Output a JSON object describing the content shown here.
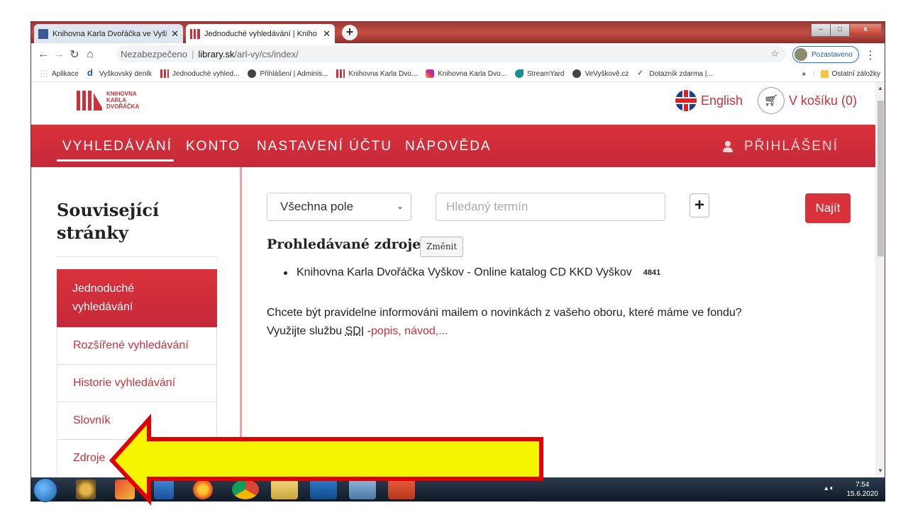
{
  "browser": {
    "tabs": [
      {
        "title": "Knihovna Karla Dvořáčka ve Vyšk",
        "active": false
      },
      {
        "title": "Jednoduché vyhledávání | Kniho",
        "active": true
      }
    ],
    "new_tab": "+",
    "window_buttons": {
      "minimize": "–",
      "maximize": "□",
      "close": "x"
    },
    "address": {
      "security": "Nezabezpečeno",
      "separator": "|",
      "host": "library.sk",
      "path": "/arl-vy/cs/index/"
    },
    "profile_label": "Pozastaveno",
    "bookmarks": [
      {
        "label": "Aplikace",
        "icon": "apps-icon"
      },
      {
        "label": "Vyškovský deník",
        "icon": "d-icon"
      },
      {
        "label": "Jednoduché vyhled...",
        "icon": "library-icon"
      },
      {
        "label": "Přihlášení | Adminis...",
        "icon": "globe-icon"
      },
      {
        "label": "Knihovna Karla Dvo...",
        "icon": "library-icon"
      },
      {
        "label": "Knihovna Karla Dvo...",
        "icon": "instagram-icon"
      },
      {
        "label": "StreamYard",
        "icon": "streamyard-icon"
      },
      {
        "label": "VeVyškově.cz",
        "icon": "globe-icon"
      },
      {
        "label": "Dotazník zdarma |...",
        "icon": "check-icon"
      }
    ],
    "bookmarks_more": "»",
    "bookmarks_other": "Ostatní záložky"
  },
  "site": {
    "logo_lines": [
      "KNIHOVNA",
      "KARLA",
      "DVOŘÁČKA"
    ],
    "language": "English",
    "cart": "V košíku (0)",
    "menu": [
      "VYHLEDÁVÁNÍ",
      "KONTO",
      "NASTAVENÍ ÚČTU",
      "NÁPOVĚDA"
    ],
    "login": "PŘIHLÁŠENÍ",
    "sidebar": {
      "title_line1": "Související",
      "title_line2": "stránky",
      "items": [
        {
          "line1": "Jednoduché",
          "line2": "vyhledávání",
          "active": true
        },
        {
          "label": "Rozšířené vyhledávání"
        },
        {
          "label": "Historie vyhledávání"
        },
        {
          "label": "Slovník"
        },
        {
          "label": "Zdroje"
        }
      ]
    },
    "search": {
      "field_select": "Všechna pole",
      "placeholder": "Hledaný termín",
      "plus": "+",
      "button": "Najít",
      "sources_title": "Prohledávané zdroje",
      "change_button": "Změnit",
      "source": "Knihovna Karla Dvořáčka Vyškov - Online katalog CD KKD Vyškov",
      "source_count": "4841",
      "info_line1": "Chcete být pravidelne informováni mailem o novinkách z vašeho oboru, které máme ve fondu?",
      "info_prefix": "Využijte službu",
      "info_abbr": "SDI",
      "info_dash": "-",
      "info_link": "popis, návod,..."
    }
  },
  "taskbar": {
    "time": "7:54",
    "date": "15.6.2020"
  },
  "colors": {
    "brand_red": "#d9323b",
    "arrow_fill": "#f5f500",
    "arrow_stroke": "#e00000"
  }
}
